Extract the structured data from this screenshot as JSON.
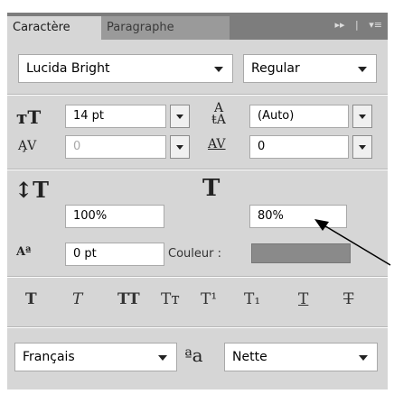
{
  "tabs": [
    {
      "label": "Caractère",
      "active": true
    },
    {
      "label": "Paragraphe",
      "active": false
    }
  ],
  "tab_icons": [
    "collapse-panel-icon",
    "panel-menu-icon"
  ],
  "font": {
    "family": "Lucida Bright",
    "style": "Regular"
  },
  "size": {
    "value": "14 pt",
    "icon": "font-size-icon"
  },
  "leading": {
    "value": "(Auto)",
    "icon": "leading-icon"
  },
  "kerning": {
    "value": "0",
    "icon": "kerning-icon",
    "disabled": true
  },
  "tracking": {
    "value": "0",
    "icon": "tracking-icon"
  },
  "vertical_scale": {
    "value": "100%",
    "icon": "vertical-scale-icon"
  },
  "horizontal_scale": {
    "value": "80%",
    "icon": "horizontal-scale-icon"
  },
  "baseline_shift": {
    "value": "0 pt",
    "icon": "baseline-shift-icon"
  },
  "color": {
    "label": "Couleur :",
    "swatch": "#8a8a8a"
  },
  "style_buttons": [
    {
      "name": "faux-bold",
      "glyph": "T"
    },
    {
      "name": "faux-italic",
      "glyph": "T"
    },
    {
      "name": "all-caps",
      "glyph": "TT"
    },
    {
      "name": "small-caps",
      "glyph": "Tт"
    },
    {
      "name": "superscript",
      "glyph": "T¹"
    },
    {
      "name": "subscript",
      "glyph": "T₁"
    },
    {
      "name": "underline",
      "glyph": "T"
    },
    {
      "name": "strikethrough",
      "glyph": "T"
    }
  ],
  "language": "Français",
  "antialias": {
    "icon_text": "aa",
    "value": "Nette"
  },
  "colors": {
    "tabbar": "#7d7d7d",
    "panel": "#d6d6d6",
    "swatch": "#8a8a8a"
  }
}
